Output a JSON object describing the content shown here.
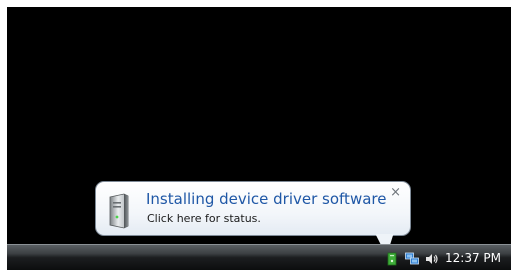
{
  "notification": {
    "title": "Installing device driver software",
    "message": "Click here for status.",
    "close_label": "×",
    "icon": "device-driver-icon",
    "title_color": "#1f57a6"
  },
  "tray": {
    "icons": [
      "device-install-icon",
      "network-icon",
      "volume-icon"
    ],
    "clock": "12:37 PM"
  }
}
